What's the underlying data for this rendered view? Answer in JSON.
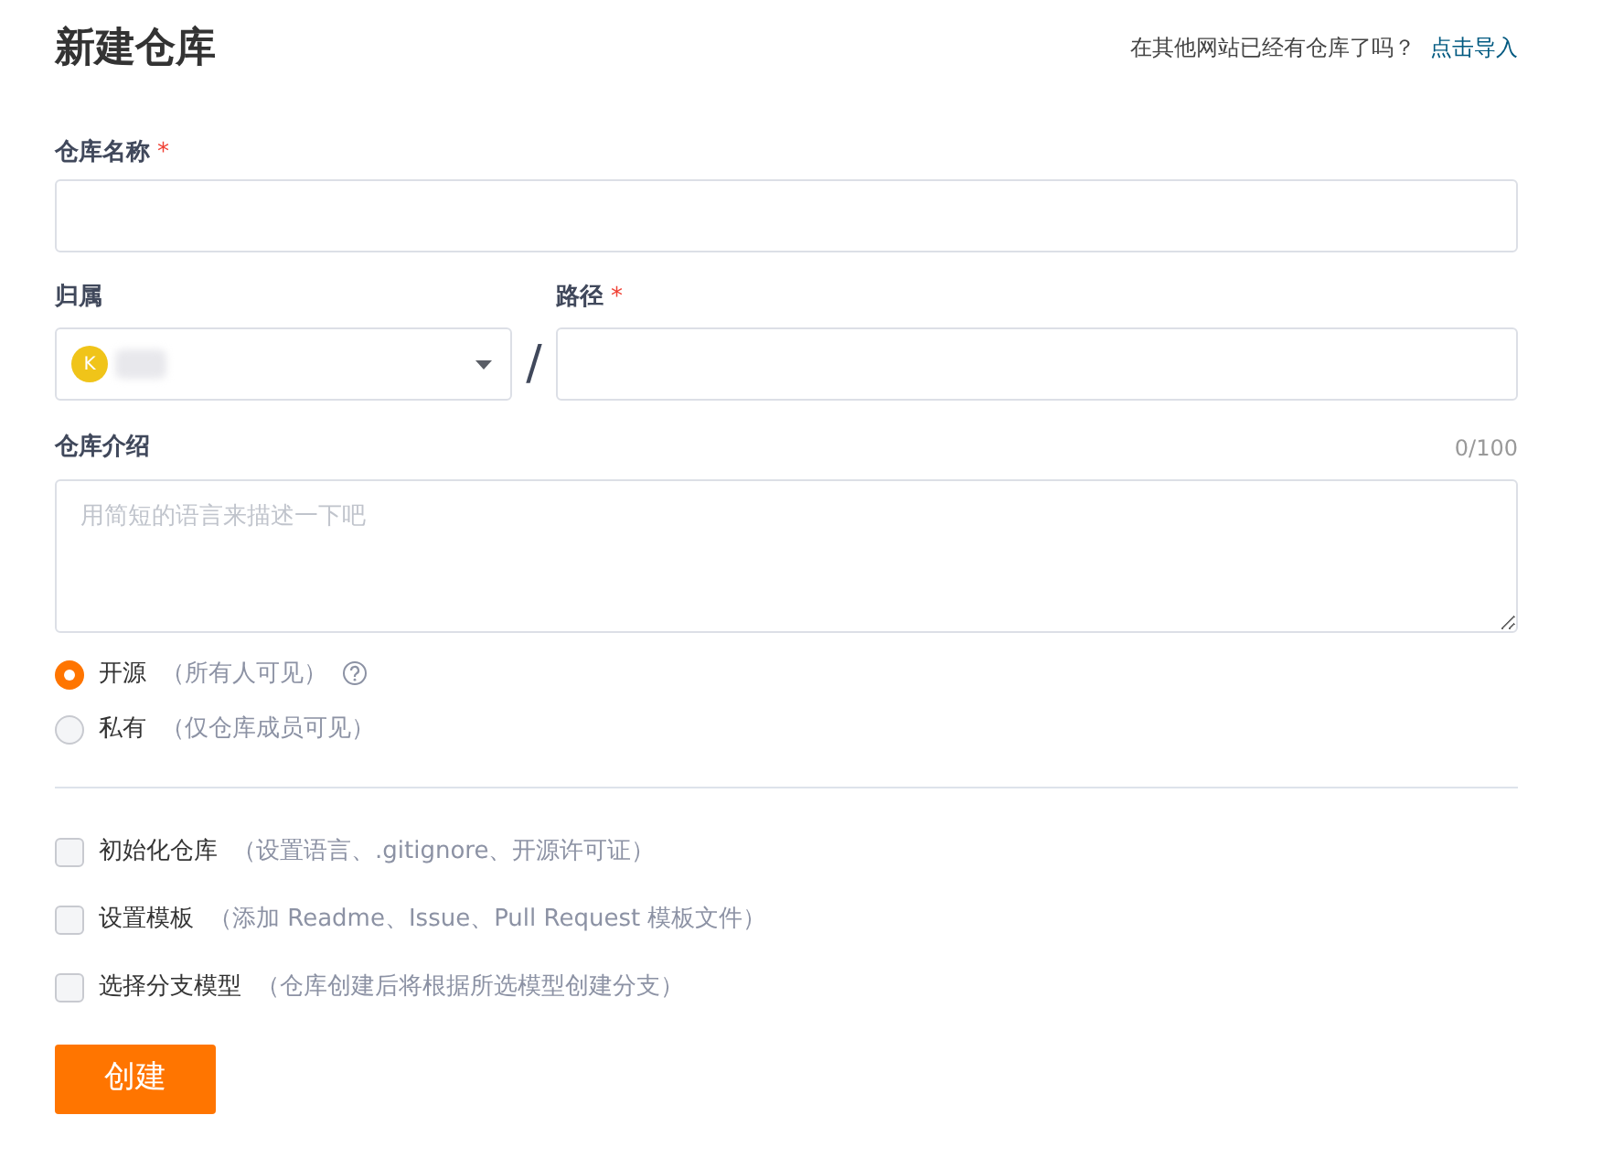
{
  "title": "新建仓库",
  "import_hint": {
    "question": "在其他网站已经有仓库了吗？",
    "link": "点击导入"
  },
  "name_field": {
    "label": "仓库名称",
    "required_mark": "*"
  },
  "owner_field": {
    "label": "归属",
    "avatar": "K"
  },
  "separator": "/",
  "path_field": {
    "label": "路径",
    "required_mark": "*"
  },
  "description_field": {
    "label": "仓库介绍",
    "counter": "0/100",
    "placeholder": "用简短的语言来描述一下吧"
  },
  "visibility": [
    {
      "label": "开源",
      "note": "（所有人可见）",
      "selected": true,
      "help": true
    },
    {
      "label": "私有",
      "note": "（仅仓库成员可见）",
      "selected": false,
      "help": false
    }
  ],
  "options": [
    {
      "label": "初始化仓库",
      "note": "（设置语言、.gitignore、开源许可证）",
      "checked": false
    },
    {
      "label": "设置模板",
      "note": "（添加 Readme、Issue、Pull Request 模板文件）",
      "checked": false
    },
    {
      "label": "选择分支模型",
      "note": "（仓库创建后将根据所选模型创建分支）",
      "checked": false
    }
  ],
  "submit": "创建"
}
